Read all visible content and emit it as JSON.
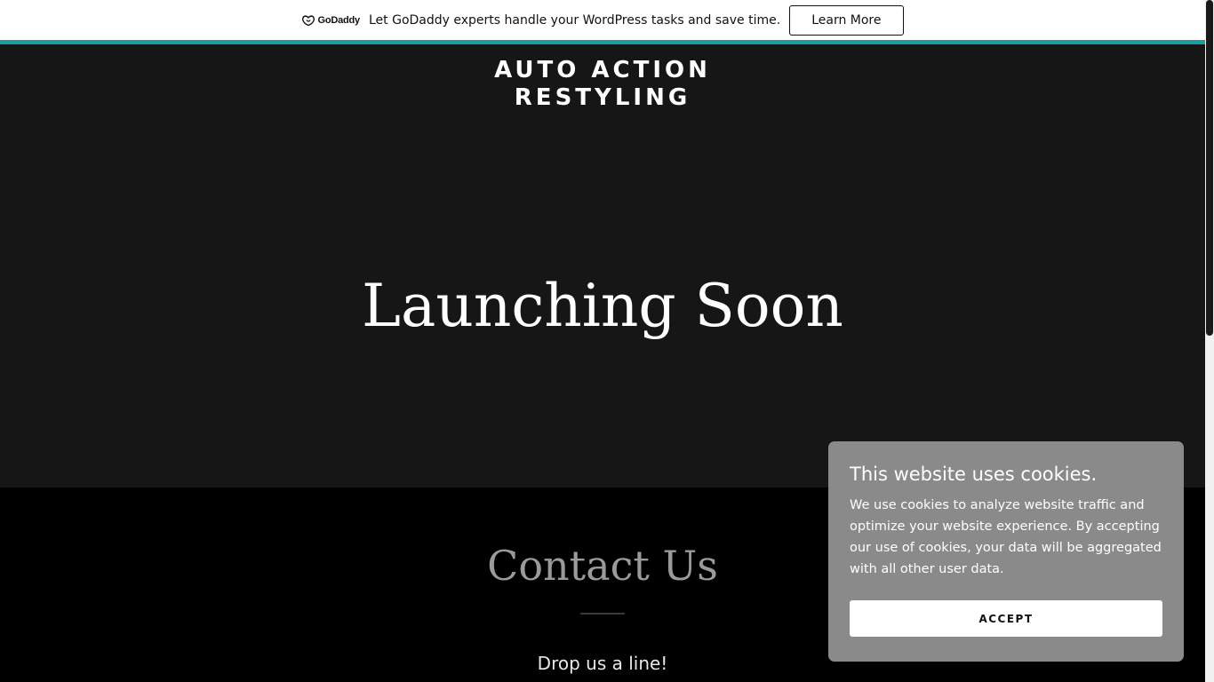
{
  "promo": {
    "logo_text": "GoDaddy",
    "message": "Let GoDaddy experts handle your WordPress tasks and save time.",
    "button_label": "Learn More"
  },
  "header": {
    "site_title": "AUTO ACTION RESTYLING"
  },
  "hero": {
    "heading": "Launching Soon"
  },
  "contact": {
    "heading": "Contact Us",
    "subheading": "Drop us a line!"
  },
  "cookie_banner": {
    "title": "This website uses cookies.",
    "body": "We use cookies to analyze website traffic and optimize your website experience. By accepting our use of cookies, your data will be aggregated with all other user data.",
    "accept_label": "ACCEPT"
  },
  "colors": {
    "accent_strip": "#1a9fa0",
    "hero_background": "#161616",
    "contact_background": "#000000",
    "cookie_background": "#8a8a8a"
  },
  "icons": {
    "logo": "godaddy-logo-icon"
  }
}
